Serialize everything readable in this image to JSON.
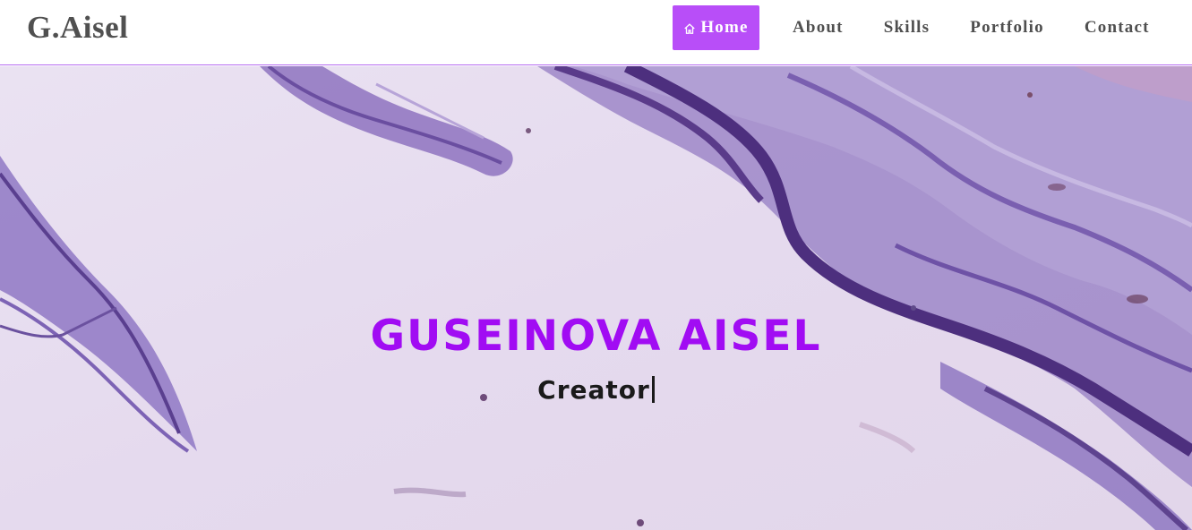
{
  "header": {
    "brand": "G.Aisel",
    "nav": [
      {
        "label": "Home",
        "icon": "home-icon",
        "active": true
      },
      {
        "label": "About"
      },
      {
        "label": "Skills"
      },
      {
        "label": "Portfolio"
      },
      {
        "label": "Contact"
      }
    ]
  },
  "hero": {
    "title": "GUSEINOVA AISEL",
    "subtitle": "Creator",
    "cursor": "|"
  },
  "colors": {
    "accent": "#b84ef8",
    "title": "#a10cf3",
    "nav_text": "#4f4f4f",
    "hero_background": "#e6dbef",
    "marble_dark": "#5b3d8c",
    "marble_mid": "#8c72c0"
  }
}
